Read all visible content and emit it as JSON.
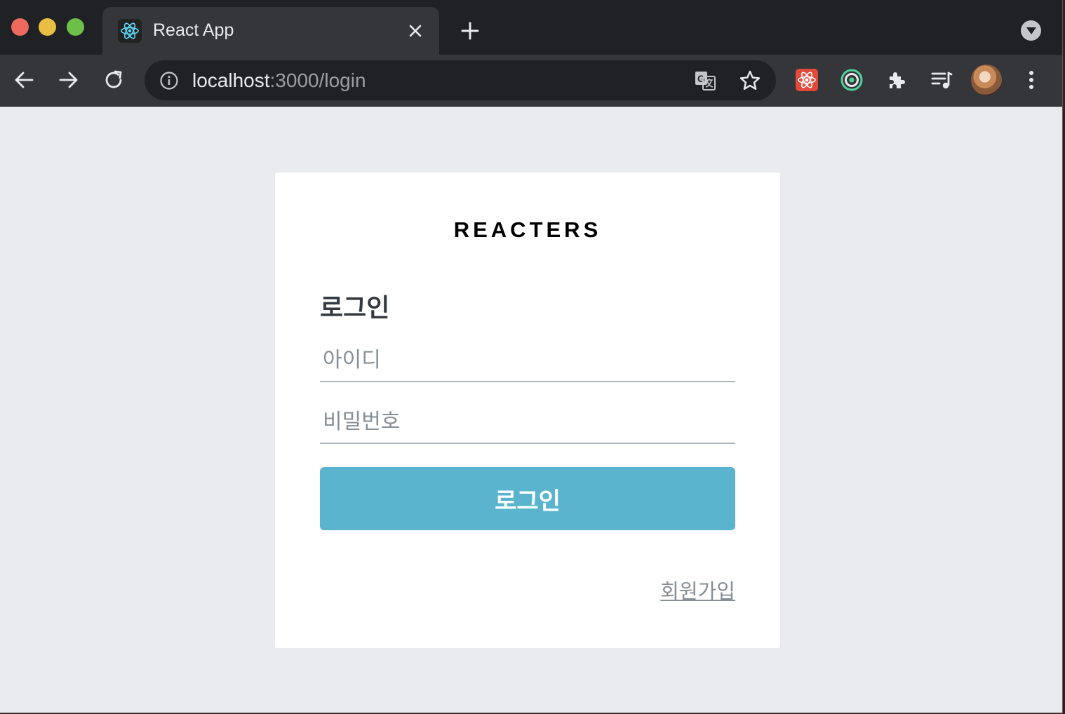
{
  "browser": {
    "tab": {
      "title": "React App",
      "favicon": "react-logo-icon"
    },
    "url": {
      "host": "localhost",
      "rest": ":3000/login"
    },
    "extensions": [
      "react-devtools-icon",
      "target-extension-icon",
      "puzzle-extensions-icon",
      "media-playlist-icon"
    ]
  },
  "page": {
    "brand": "REACTERS",
    "title": "로그인",
    "username_placeholder": "아이디",
    "password_placeholder": "비밀번호",
    "submit_label": "로그인",
    "signup_link": "회원가입",
    "button_color": "#5ab4cd"
  }
}
